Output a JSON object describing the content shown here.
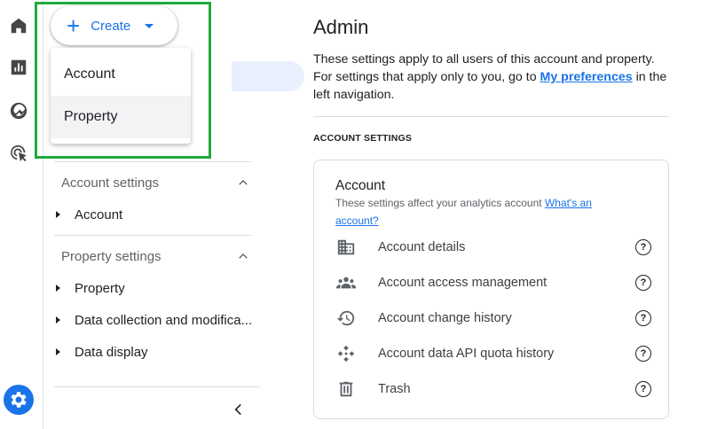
{
  "rail": {
    "icons": [
      "home-icon",
      "reports-icon",
      "explore-icon",
      "advertising-icon",
      "admin-gear-icon"
    ]
  },
  "create": {
    "label": "Create",
    "menu": [
      "Account",
      "Property"
    ]
  },
  "nav": {
    "account_settings": {
      "title": "Account settings",
      "items": [
        "Account"
      ]
    },
    "property_settings": {
      "title": "Property settings",
      "items": [
        "Property",
        "Data collection and modifica...",
        "Data display"
      ]
    }
  },
  "main": {
    "title": "Admin",
    "desc_1": "These settings apply to all users of this account and property. For settings that apply only to you, go to ",
    "desc_link": "My preferences",
    "desc_2": " in the left navigation.",
    "section_label": "ACCOUNT SETTINGS",
    "card": {
      "title": "Account",
      "subtitle": "These settings affect your analytics account ",
      "subtitle_link": "What's an account?",
      "rows": [
        {
          "label": "Account details",
          "icon": "building-icon"
        },
        {
          "label": "Account access management",
          "icon": "people-icon"
        },
        {
          "label": "Account change history",
          "icon": "history-icon"
        },
        {
          "label": "Account data API quota history",
          "icon": "api-icon"
        },
        {
          "label": "Trash",
          "icon": "trash-icon"
        }
      ],
      "help_glyph": "?"
    }
  }
}
